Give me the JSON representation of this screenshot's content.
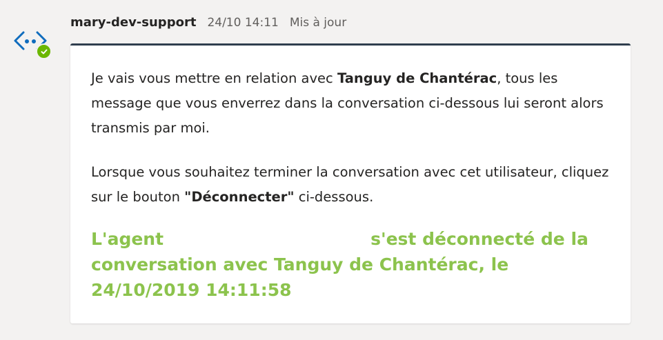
{
  "message": {
    "sender": "mary-dev-support",
    "timestamp": "24/10 14:11",
    "edited_label": "Mis à jour",
    "avatar_icon": "bot-code-icon",
    "status_icon": "check-circle-icon",
    "status_color": "#6bb700"
  },
  "card": {
    "paragraph1": {
      "before": "Je vais vous mettre en relation avec ",
      "name": "Tanguy de Chantérac",
      "after": ", tous les message que vous enverrez dans la conversation ci-dessous lui seront alors transmis par moi."
    },
    "paragraph2": {
      "before": "Lorsque vous souhaitez terminer la conversation avec cet utilisateur, cliquez sur le bouton ",
      "button_name": "\"Déconnecter\"",
      "after": " ci-dessous."
    },
    "notice": {
      "prefix": "L'agent",
      "suffix": "s'est déconnecté de la conversation avec Tanguy de Chantérac, le 24/10/2019 14:11:58",
      "color": "#8cc34d"
    },
    "accent_color": "#2f3e4e"
  }
}
